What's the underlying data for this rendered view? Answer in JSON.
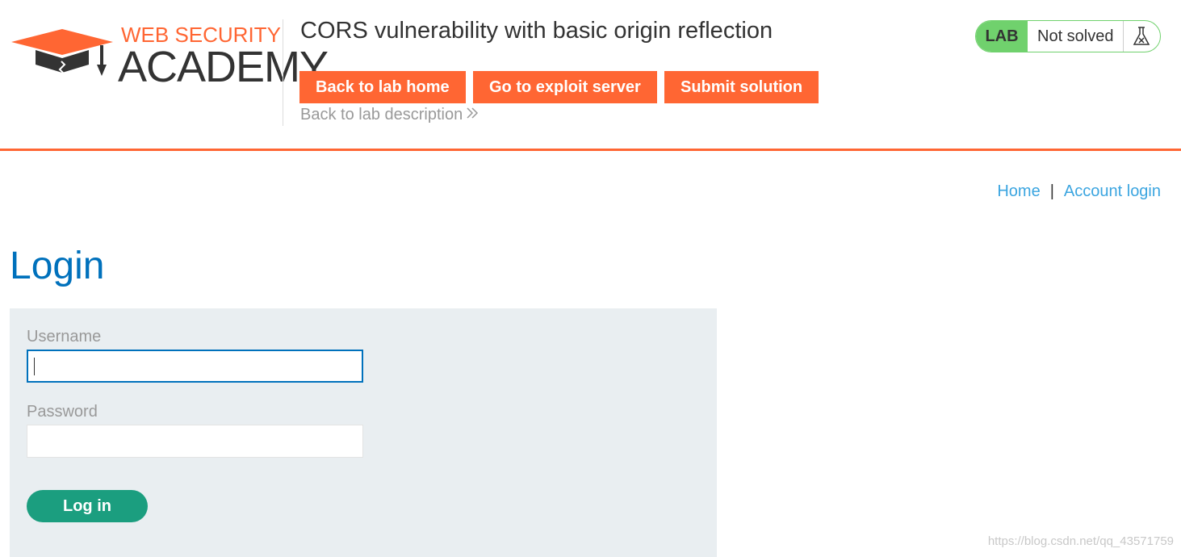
{
  "header": {
    "logo": {
      "top_text": "WEB SECURITY",
      "bottom_text": "ACADEMY",
      "icon": "graduation-cap-icon"
    },
    "lab_title": "CORS vulnerability with basic origin reflection",
    "buttons": {
      "back_home": "Back to lab home",
      "exploit_server": "Go to exploit server",
      "submit_solution": "Submit solution"
    },
    "back_description": "Back to lab description",
    "lab_status": {
      "tag": "LAB",
      "text": "Not solved",
      "icon": "flask-icon"
    }
  },
  "nav": {
    "home": "Home",
    "separator": "|",
    "account_login": "Account login"
  },
  "main": {
    "heading": "Login",
    "form": {
      "username_label": "Username",
      "username_value": "",
      "password_label": "Password",
      "password_value": "",
      "submit_label": "Log in"
    }
  },
  "watermark": "https://blog.csdn.net/qq_43571759",
  "colors": {
    "accent": "#ff6633",
    "link": "#3ba5e0",
    "heading": "#0071bc",
    "status_green": "#70d16d",
    "login_button": "#1b9e7f",
    "panel_bg": "#e9eef1"
  }
}
